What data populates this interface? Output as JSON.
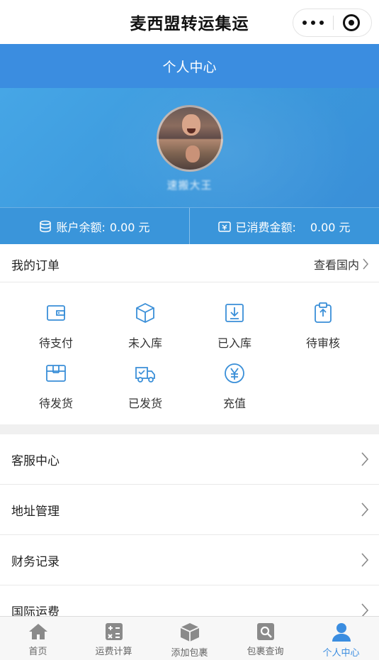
{
  "app": {
    "title": "麦西盟转运集运"
  },
  "header": {
    "title": "个人中心"
  },
  "profile": {
    "username": "速搬大王"
  },
  "balance": {
    "account_label": "账户余额:",
    "account_value": "0.00 元",
    "spent_label": "已消费金额:",
    "spent_value": "0.00 元"
  },
  "orders": {
    "title": "我的订单",
    "view_link": "查看国内",
    "items": [
      {
        "label": "待支付",
        "icon": "wallet-icon"
      },
      {
        "label": "未入库",
        "icon": "box-icon"
      },
      {
        "label": "已入库",
        "icon": "download-icon"
      },
      {
        "label": "待审核",
        "icon": "clipboard-icon"
      },
      {
        "label": "待发货",
        "icon": "package-icon"
      },
      {
        "label": "已发货",
        "icon": "truck-icon"
      },
      {
        "label": "充值",
        "icon": "yen-icon"
      }
    ]
  },
  "menu": [
    {
      "label": "客服中心"
    },
    {
      "label": "地址管理"
    },
    {
      "label": "财务记录"
    },
    {
      "label": "国际运费"
    }
  ],
  "tabbar": [
    {
      "label": "首页",
      "icon": "home-icon"
    },
    {
      "label": "运费计算",
      "icon": "calculator-icon"
    },
    {
      "label": "添加包裹",
      "icon": "cube-icon"
    },
    {
      "label": "包裹查询",
      "icon": "search-icon"
    },
    {
      "label": "个人中心",
      "icon": "user-icon",
      "active": true
    }
  ],
  "colors": {
    "accent": "#3b8de0",
    "icon_blue": "#3a8fd8"
  }
}
